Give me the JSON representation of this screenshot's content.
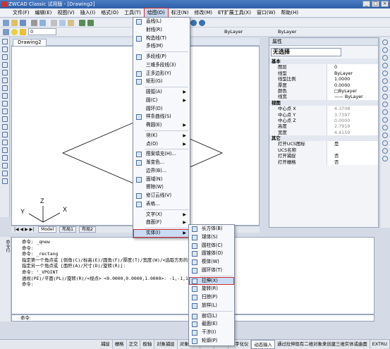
{
  "window": {
    "title": "ZWCAD Classic 试用版 - [Drawing2]",
    "buttons": [
      "_",
      "□",
      "×"
    ]
  },
  "menubar": [
    {
      "label": "文件(F)"
    },
    {
      "label": "编辑(E)"
    },
    {
      "label": "视图(V)"
    },
    {
      "label": "插入(I)"
    },
    {
      "label": "格式(O)"
    },
    {
      "label": "工具(T)"
    },
    {
      "label": "绘图(D)",
      "active": true
    },
    {
      "label": "标注(N)"
    },
    {
      "label": "修改(M)"
    },
    {
      "label": "ET扩展工具(X)"
    },
    {
      "label": "窗口(W)"
    },
    {
      "label": "帮助(H)"
    }
  ],
  "toolbar": {
    "layer_value": "0",
    "linetype": "ByLayer",
    "lineweight": "ByLayer"
  },
  "drawing_tab": "Drawing2",
  "layout_tabs": [
    "Model",
    "布局1",
    "布局2"
  ],
  "axes": {
    "x": "X",
    "y": "Y",
    "z": "Z"
  },
  "draw_menu": [
    {
      "label": "直线(L)",
      "icon": "line-icon"
    },
    {
      "label": "射线(R)"
    },
    {
      "label": "构造线(T)",
      "icon": "xline-icon"
    },
    {
      "label": "多线(M)"
    },
    {
      "sep": true
    },
    {
      "label": "多段线(P)",
      "icon": "polyline-icon"
    },
    {
      "label": "三维多段线(3)"
    },
    {
      "label": "正多边形(Y)",
      "icon": "polygon-icon"
    },
    {
      "label": "矩形(G)",
      "icon": "rectangle-icon"
    },
    {
      "sep": true
    },
    {
      "label": "圆弧(A)",
      "submenu": true
    },
    {
      "label": "圆(C)",
      "submenu": true
    },
    {
      "label": "圆环(D)"
    },
    {
      "label": "样条曲线(S)",
      "icon": "spline-icon"
    },
    {
      "label": "椭圆(E)",
      "submenu": true
    },
    {
      "sep": true
    },
    {
      "label": "块(K)",
      "submenu": true
    },
    {
      "label": "点(O)",
      "submenu": true
    },
    {
      "sep": true
    },
    {
      "label": "图案填充(H)...",
      "icon": "hatch-icon"
    },
    {
      "label": "渐变色...",
      "icon": "gradient-icon"
    },
    {
      "label": "边界(B)..."
    },
    {
      "label": "面域(N)",
      "icon": "region-icon"
    },
    {
      "label": "擦除(W)"
    },
    {
      "label": "修订云线(V)",
      "icon": "revcloud-icon"
    },
    {
      "label": "表格...",
      "icon": "table-icon"
    },
    {
      "sep": true
    },
    {
      "label": "文字(X)",
      "submenu": true
    },
    {
      "label": "曲面(F)",
      "submenu": true
    },
    {
      "sep": true
    },
    {
      "label": "实体(I)",
      "submenu": true,
      "boxed": true
    }
  ],
  "solid_menu": [
    {
      "label": "长方体(B)",
      "icon": "box-icon"
    },
    {
      "label": "球体(S)",
      "icon": "sphere-icon"
    },
    {
      "label": "圆柱体(C)",
      "icon": "cylinder-icon"
    },
    {
      "label": "圆锥体(O)",
      "icon": "cone-icon"
    },
    {
      "label": "楔体(W)",
      "icon": "wedge-icon"
    },
    {
      "label": "圆环体(T)",
      "icon": "torus-icon"
    },
    {
      "sep": true
    },
    {
      "label": "拉伸(X)",
      "icon": "extrude-icon",
      "boxed": true
    },
    {
      "label": "旋转(R)",
      "icon": "revolve-icon"
    },
    {
      "label": "扫掠(P)",
      "icon": "sweep-icon"
    },
    {
      "label": "放样(L)",
      "icon": "loft-icon"
    },
    {
      "sep": true
    },
    {
      "label": "剖切(L)",
      "icon": "slice-icon"
    },
    {
      "label": "截面(E)",
      "icon": "section-icon"
    },
    {
      "label": "干涉(I)",
      "icon": "interfere-icon"
    },
    {
      "label": "轮廓(P)",
      "icon": "profile-icon"
    }
  ],
  "properties": {
    "title": "属性",
    "selection": "无选择",
    "rows": [
      {
        "section": "基本"
      },
      {
        "k": "图层",
        "v": "0"
      },
      {
        "k": "线型",
        "v": "ByLayer"
      },
      {
        "k": "线型比例",
        "v": "1.0000"
      },
      {
        "k": "厚度",
        "v": "0.0000"
      },
      {
        "k": "颜色",
        "v": "□ByLayer"
      },
      {
        "k": "线宽",
        "v": "—— ByLayer"
      },
      {
        "section": "视图"
      },
      {
        "k": "中心点 X",
        "v": "4.3708",
        "gray": true
      },
      {
        "k": "中心点 Y",
        "v": "3.7397",
        "gray": true
      },
      {
        "k": "中心点 Z",
        "v": "0.0000",
        "gray": true
      },
      {
        "k": "高度",
        "v": "2.7919",
        "gray": true
      },
      {
        "k": "宽度",
        "v": "4.4159",
        "gray": true
      },
      {
        "section": "其它"
      },
      {
        "k": "打开UCS图标",
        "v": "是"
      },
      {
        "k": "UCS名称",
        "v": ""
      },
      {
        "k": "打开捕捉",
        "v": "否"
      },
      {
        "k": "打开栅格",
        "v": "否"
      }
    ]
  },
  "command": {
    "side_label": "命令行",
    "history": [
      "命令: _qnew",
      "命令:",
      "命令: _rectang",
      "指定第一个角点或 [倒角(C)/标高(E)/圆角(F)/厚度(T)/宽度(W)/<选取方形的第一点>:",
      "指定另一个角点或 [面积(A)/尺寸(D)/旋转(R)]:",
      "命令: '_VPOINT",
      "透视(PE)/平面(PL)/旋转(R)/<视点> <0.0000,0.0000,1.0000>: -1,-1,1",
      "命令:"
    ],
    "prompt": "命令:"
  },
  "status": {
    "items": [
      "捕捉",
      "栅格",
      "正交",
      "极轴",
      "对象捕捉",
      "对象追踪",
      "线宽",
      "模型",
      "数字化仪",
      "动态输入",
      "通过拉伸现有二维对象来创建三维实体或曲面",
      "EXTRU"
    ],
    "on": [
      "动态输入"
    ]
  },
  "colors": {
    "accent": "#d03030",
    "highlight": "#c9dcf4",
    "title_bar": "#2d5fa8"
  }
}
